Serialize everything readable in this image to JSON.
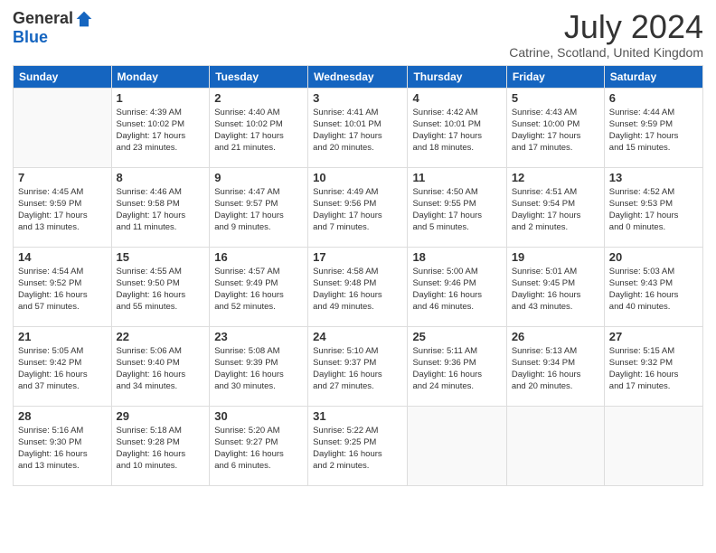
{
  "logo": {
    "general": "General",
    "blue": "Blue"
  },
  "title": "July 2024",
  "subtitle": "Catrine, Scotland, United Kingdom",
  "days_of_week": [
    "Sunday",
    "Monday",
    "Tuesday",
    "Wednesday",
    "Thursday",
    "Friday",
    "Saturday"
  ],
  "weeks": [
    [
      {
        "day": "",
        "sunrise": "",
        "sunset": "",
        "daylight": ""
      },
      {
        "day": "1",
        "sunrise": "Sunrise: 4:39 AM",
        "sunset": "Sunset: 10:02 PM",
        "daylight": "Daylight: 17 hours and 23 minutes."
      },
      {
        "day": "2",
        "sunrise": "Sunrise: 4:40 AM",
        "sunset": "Sunset: 10:02 PM",
        "daylight": "Daylight: 17 hours and 21 minutes."
      },
      {
        "day": "3",
        "sunrise": "Sunrise: 4:41 AM",
        "sunset": "Sunset: 10:01 PM",
        "daylight": "Daylight: 17 hours and 20 minutes."
      },
      {
        "day": "4",
        "sunrise": "Sunrise: 4:42 AM",
        "sunset": "Sunset: 10:01 PM",
        "daylight": "Daylight: 17 hours and 18 minutes."
      },
      {
        "day": "5",
        "sunrise": "Sunrise: 4:43 AM",
        "sunset": "Sunset: 10:00 PM",
        "daylight": "Daylight: 17 hours and 17 minutes."
      },
      {
        "day": "6",
        "sunrise": "Sunrise: 4:44 AM",
        "sunset": "Sunset: 9:59 PM",
        "daylight": "Daylight: 17 hours and 15 minutes."
      }
    ],
    [
      {
        "day": "7",
        "sunrise": "Sunrise: 4:45 AM",
        "sunset": "Sunset: 9:59 PM",
        "daylight": "Daylight: 17 hours and 13 minutes."
      },
      {
        "day": "8",
        "sunrise": "Sunrise: 4:46 AM",
        "sunset": "Sunset: 9:58 PM",
        "daylight": "Daylight: 17 hours and 11 minutes."
      },
      {
        "day": "9",
        "sunrise": "Sunrise: 4:47 AM",
        "sunset": "Sunset: 9:57 PM",
        "daylight": "Daylight: 17 hours and 9 minutes."
      },
      {
        "day": "10",
        "sunrise": "Sunrise: 4:49 AM",
        "sunset": "Sunset: 9:56 PM",
        "daylight": "Daylight: 17 hours and 7 minutes."
      },
      {
        "day": "11",
        "sunrise": "Sunrise: 4:50 AM",
        "sunset": "Sunset: 9:55 PM",
        "daylight": "Daylight: 17 hours and 5 minutes."
      },
      {
        "day": "12",
        "sunrise": "Sunrise: 4:51 AM",
        "sunset": "Sunset: 9:54 PM",
        "daylight": "Daylight: 17 hours and 2 minutes."
      },
      {
        "day": "13",
        "sunrise": "Sunrise: 4:52 AM",
        "sunset": "Sunset: 9:53 PM",
        "daylight": "Daylight: 17 hours and 0 minutes."
      }
    ],
    [
      {
        "day": "14",
        "sunrise": "Sunrise: 4:54 AM",
        "sunset": "Sunset: 9:52 PM",
        "daylight": "Daylight: 16 hours and 57 minutes."
      },
      {
        "day": "15",
        "sunrise": "Sunrise: 4:55 AM",
        "sunset": "Sunset: 9:50 PM",
        "daylight": "Daylight: 16 hours and 55 minutes."
      },
      {
        "day": "16",
        "sunrise": "Sunrise: 4:57 AM",
        "sunset": "Sunset: 9:49 PM",
        "daylight": "Daylight: 16 hours and 52 minutes."
      },
      {
        "day": "17",
        "sunrise": "Sunrise: 4:58 AM",
        "sunset": "Sunset: 9:48 PM",
        "daylight": "Daylight: 16 hours and 49 minutes."
      },
      {
        "day": "18",
        "sunrise": "Sunrise: 5:00 AM",
        "sunset": "Sunset: 9:46 PM",
        "daylight": "Daylight: 16 hours and 46 minutes."
      },
      {
        "day": "19",
        "sunrise": "Sunrise: 5:01 AM",
        "sunset": "Sunset: 9:45 PM",
        "daylight": "Daylight: 16 hours and 43 minutes."
      },
      {
        "day": "20",
        "sunrise": "Sunrise: 5:03 AM",
        "sunset": "Sunset: 9:43 PM",
        "daylight": "Daylight: 16 hours and 40 minutes."
      }
    ],
    [
      {
        "day": "21",
        "sunrise": "Sunrise: 5:05 AM",
        "sunset": "Sunset: 9:42 PM",
        "daylight": "Daylight: 16 hours and 37 minutes."
      },
      {
        "day": "22",
        "sunrise": "Sunrise: 5:06 AM",
        "sunset": "Sunset: 9:40 PM",
        "daylight": "Daylight: 16 hours and 34 minutes."
      },
      {
        "day": "23",
        "sunrise": "Sunrise: 5:08 AM",
        "sunset": "Sunset: 9:39 PM",
        "daylight": "Daylight: 16 hours and 30 minutes."
      },
      {
        "day": "24",
        "sunrise": "Sunrise: 5:10 AM",
        "sunset": "Sunset: 9:37 PM",
        "daylight": "Daylight: 16 hours and 27 minutes."
      },
      {
        "day": "25",
        "sunrise": "Sunrise: 5:11 AM",
        "sunset": "Sunset: 9:36 PM",
        "daylight": "Daylight: 16 hours and 24 minutes."
      },
      {
        "day": "26",
        "sunrise": "Sunrise: 5:13 AM",
        "sunset": "Sunset: 9:34 PM",
        "daylight": "Daylight: 16 hours and 20 minutes."
      },
      {
        "day": "27",
        "sunrise": "Sunrise: 5:15 AM",
        "sunset": "Sunset: 9:32 PM",
        "daylight": "Daylight: 16 hours and 17 minutes."
      }
    ],
    [
      {
        "day": "28",
        "sunrise": "Sunrise: 5:16 AM",
        "sunset": "Sunset: 9:30 PM",
        "daylight": "Daylight: 16 hours and 13 minutes."
      },
      {
        "day": "29",
        "sunrise": "Sunrise: 5:18 AM",
        "sunset": "Sunset: 9:28 PM",
        "daylight": "Daylight: 16 hours and 10 minutes."
      },
      {
        "day": "30",
        "sunrise": "Sunrise: 5:20 AM",
        "sunset": "Sunset: 9:27 PM",
        "daylight": "Daylight: 16 hours and 6 minutes."
      },
      {
        "day": "31",
        "sunrise": "Sunrise: 5:22 AM",
        "sunset": "Sunset: 9:25 PM",
        "daylight": "Daylight: 16 hours and 2 minutes."
      },
      {
        "day": "",
        "sunrise": "",
        "sunset": "",
        "daylight": ""
      },
      {
        "day": "",
        "sunrise": "",
        "sunset": "",
        "daylight": ""
      },
      {
        "day": "",
        "sunrise": "",
        "sunset": "",
        "daylight": ""
      }
    ]
  ]
}
